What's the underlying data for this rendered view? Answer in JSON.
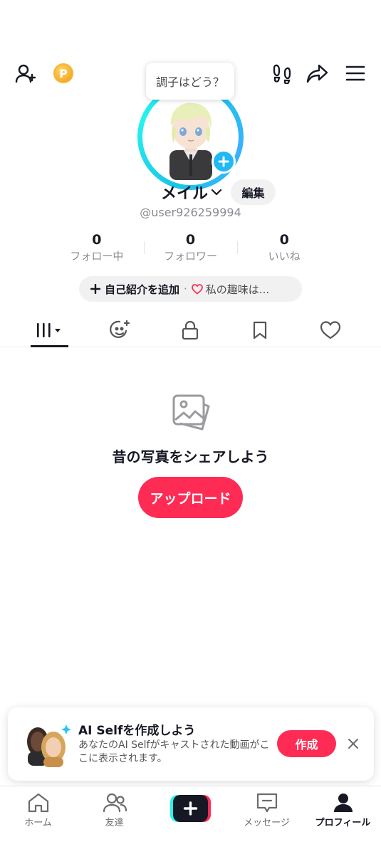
{
  "status_bubble": "調子はどう？",
  "profile": {
    "display_name": "メイル",
    "edit_label": "編集",
    "username": "@user926259994"
  },
  "stats": [
    {
      "value": "0",
      "label": "フォロー中"
    },
    {
      "value": "0",
      "label": "フォロワー"
    },
    {
      "value": "0",
      "label": "いいね"
    }
  ],
  "bio": {
    "add_label": "自己紹介を追加",
    "separator": "·",
    "interest": "私の趣味は..."
  },
  "empty_state": {
    "title": "昔の写真をシェアしよう",
    "upload_label": "アップロード"
  },
  "ai_card": {
    "title": "AI Selfを作成しよう",
    "description": "あなたのAI Selfがキャストされた動画がここに表示されます。",
    "create_label": "作成"
  },
  "bottom_nav": {
    "home": "ホーム",
    "friends": "友達",
    "messages": "メッセージ",
    "profile": "プロフィール"
  },
  "colors": {
    "accent": "#fe2c55",
    "ring": "#25f4ee",
    "badge": "#20b8f5"
  },
  "icons": {
    "add_friend": "add-user-icon",
    "coin": "coin-icon",
    "footprints": "footprints-icon",
    "share": "share-icon",
    "menu": "menu-icon"
  }
}
